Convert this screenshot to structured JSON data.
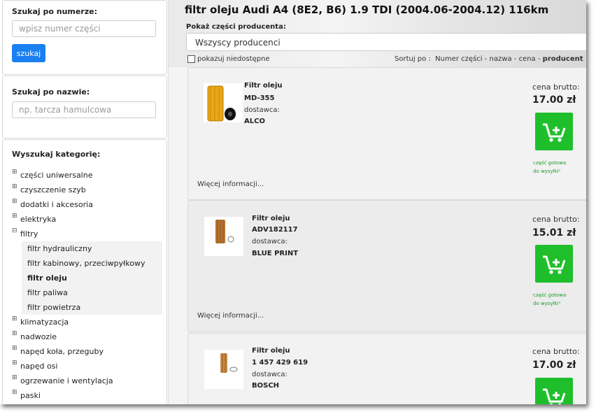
{
  "sidebar": {
    "search_number": {
      "title": "Szukaj po numerze:",
      "placeholder": "wpisz numer części",
      "button": "szukaj"
    },
    "search_name": {
      "title": "Szukaj po nazwie:",
      "placeholder": "np. tarcza hamulcowa"
    },
    "categories": {
      "title": "Wyszukaj kategorię:",
      "items": [
        "części uniwersalne",
        "czyszczenie szyb",
        "dodatki i akcesoria",
        "elektryka",
        "filtry"
      ],
      "filters_children": [
        "filtr hydrauliczny",
        "filtr kabinowy, przeciwpyłkowy",
        "filtr oleju",
        "filtr paliwa",
        "filtr powietrza"
      ],
      "items_after": [
        "klimatyzacja",
        "nadwozie",
        "napęd koła, przeguby",
        "napęd osi",
        "ogrzewanie i wentylacja",
        "paski"
      ]
    }
  },
  "main": {
    "title": "filtr oleju Audi A4 (8E2, B6) 1.9 TDI (2004.06-2004.12) 116km",
    "producer_label": "Pokaż części producenta:",
    "producer_select": "Wszyscy producenci",
    "show_unavailable": "pokazuj niedostępne",
    "sort": {
      "label": "Sortuj po :",
      "options": [
        "Numer części",
        "nazwa",
        "cena",
        "producent"
      ],
      "separator": "-"
    },
    "products": [
      {
        "name": "Filtr oleju",
        "code": "MD-355",
        "supplier_label": "dostawca:",
        "supplier": "ALCO",
        "price_label": "cena brutto:",
        "price": "17.00 zł",
        "ready_line1": "część gotowa",
        "ready_line2": "do wysyłki¹",
        "more": "Więcej informacji..."
      },
      {
        "name": "Filtr oleju",
        "code": "ADV182117",
        "supplier_label": "dostawca:",
        "supplier": "BLUE PRINT",
        "price_label": "cena brutto:",
        "price": "15.01 zł",
        "ready_line1": "część gotowa",
        "ready_line2": "do wysyłki¹",
        "more": "Więcej informacji..."
      },
      {
        "name": "Filtr oleju",
        "code": "1 457 429 619",
        "supplier_label": "dostawca:",
        "supplier": "BOSCH",
        "price_label": "cena brutto:",
        "price": "17.00 zł"
      }
    ]
  },
  "colors": {
    "accent_blue": "#1a7ff0",
    "cart_green": "#1fbf2c",
    "ready_green": "#1e9a2a"
  },
  "icons": {
    "cart": "cart-plus-icon",
    "expand": "plus-icon",
    "collapse": "minus-icon"
  }
}
